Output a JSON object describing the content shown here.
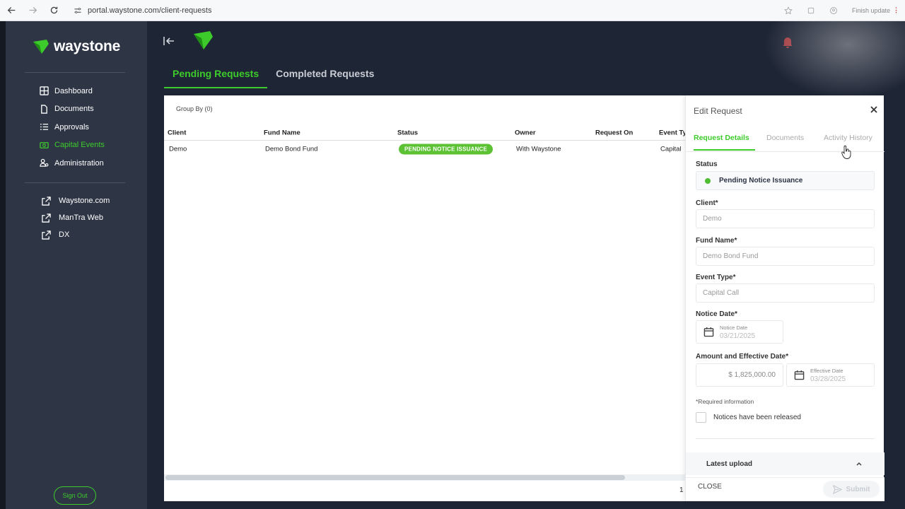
{
  "browser": {
    "url": "portal.waystone.com/client-requests",
    "update_label": "Finish update"
  },
  "sidebar": {
    "brand": "waystone",
    "nav": [
      {
        "label": "Dashboard",
        "icon": "grid-icon"
      },
      {
        "label": "Documents",
        "icon": "document-icon"
      },
      {
        "label": "Approvals",
        "icon": "list-check-icon"
      },
      {
        "label": "Capital Events",
        "icon": "money-icon",
        "active": true
      },
      {
        "label": "Administration",
        "icon": "users-cog-icon"
      }
    ],
    "links": [
      {
        "label": "Waystone.com",
        "icon": "external-link-icon"
      },
      {
        "label": "ManTra Web",
        "icon": "external-link-icon"
      },
      {
        "label": "DX",
        "icon": "external-link-icon"
      }
    ],
    "sign_out": "Sign Out"
  },
  "header": {
    "tabs": [
      {
        "label": "Pending Requests",
        "active": true
      },
      {
        "label": "Completed Requests",
        "active": false
      }
    ]
  },
  "table": {
    "group_by": "Group By (0)",
    "columns": [
      "Client",
      "Fund Name",
      "Status",
      "Owner",
      "Request On",
      "Event Ty"
    ],
    "rows": [
      {
        "client": "Demo",
        "fund": "Demo Bond Fund",
        "status": "PENDING NOTICE ISSUANCE",
        "owner": "With Waystone",
        "request_on": "",
        "event": "Capital"
      }
    ],
    "page": "1"
  },
  "panel": {
    "title": "Edit Request",
    "tabs": [
      "Request Details",
      "Documents",
      "Activity History"
    ],
    "status_label": "Status",
    "status_value": "Pending Notice Issuance",
    "client_label": "Client*",
    "client_value": "Demo",
    "fund_label": "Fund Name*",
    "fund_value": "Demo Bond Fund",
    "event_label": "Event Type*",
    "event_value": "Capital Call",
    "notice_label": "Notice Date*",
    "notice_small": "Notice Date",
    "notice_value": "03/21/2025",
    "amount_label": "Amount and Effective Date*",
    "amount_value": "$ 1,825,000.00",
    "effective_small": "Effective Date",
    "effective_value": "03/28/2025",
    "required_info": "*Required information",
    "checkbox_label": "Notices have been released",
    "latest_upload": "Latest upload",
    "close": "CLOSE",
    "submit": "Submit"
  },
  "colors": {
    "accent": "#3dcb2b",
    "sidebar_bg": "#2e3646",
    "main_bg": "#1e2535"
  }
}
